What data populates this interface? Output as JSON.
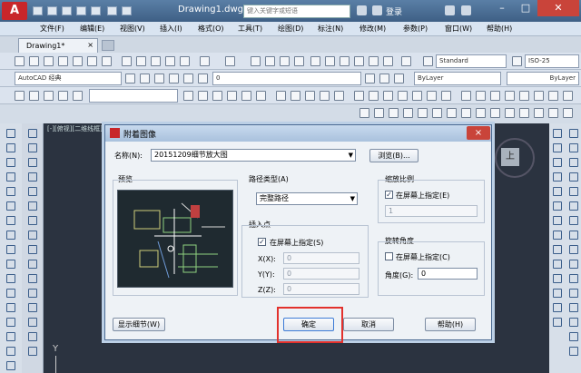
{
  "titlebar": {
    "logo_text": "A",
    "doc_title": "Drawing1.dwg",
    "search_placeholder": "键入关键字或短语",
    "login": "登录"
  },
  "menu": [
    "文件(F)",
    "编辑(E)",
    "视图(V)",
    "插入(I)",
    "格式(O)",
    "工具(T)",
    "绘图(D)",
    "标注(N)",
    "修改(M)",
    "参数(P)",
    "窗口(W)",
    "帮助(H)"
  ],
  "tabs": {
    "doc_tab": "Drawing1*",
    "close_glyph": "×"
  },
  "toolbar": {
    "text_style": "Standard",
    "dim_style": "ISO-25",
    "workspace": "AutoCAD 经典",
    "layer": "0",
    "color": "ByLayer",
    "linetype": "ByLayer"
  },
  "canvas": {
    "view_label": "[-][俯视][二维线框]",
    "ucs_y": "Y",
    "viewcube_top": "上"
  },
  "dialog": {
    "title": "附着图像",
    "close_glyph": "×",
    "name_label": "名称(N):",
    "name_value": "20151209细节放大图",
    "browse_button": "浏览(B)...",
    "preview_label": "预览",
    "path_type_label": "路径类型(A)",
    "path_type_value": "完整路径",
    "insert_point_label": "插入点",
    "insert_specify": "在屏幕上指定(S)",
    "x_label": "X(X):",
    "y_label": "Y(Y):",
    "z_label": "Z(Z):",
    "x_value": "0",
    "y_value": "0",
    "z_value": "0",
    "scale_label": "缩放比例",
    "scale_specify": "在屏幕上指定(E)",
    "scale_value": "1",
    "rotation_label": "旋转角度",
    "rotation_specify": "在屏幕上指定(C)",
    "angle_label": "角度(G):",
    "angle_value": "0",
    "details_button": "显示细节(W)",
    "ok_button": "确定",
    "cancel_button": "取消",
    "help_button": "帮助(H)",
    "checked_glyph": "✓",
    "combo_arrow": "▼"
  },
  "colors": {
    "highlight": "#e2312c",
    "brand": "#c8262a"
  }
}
